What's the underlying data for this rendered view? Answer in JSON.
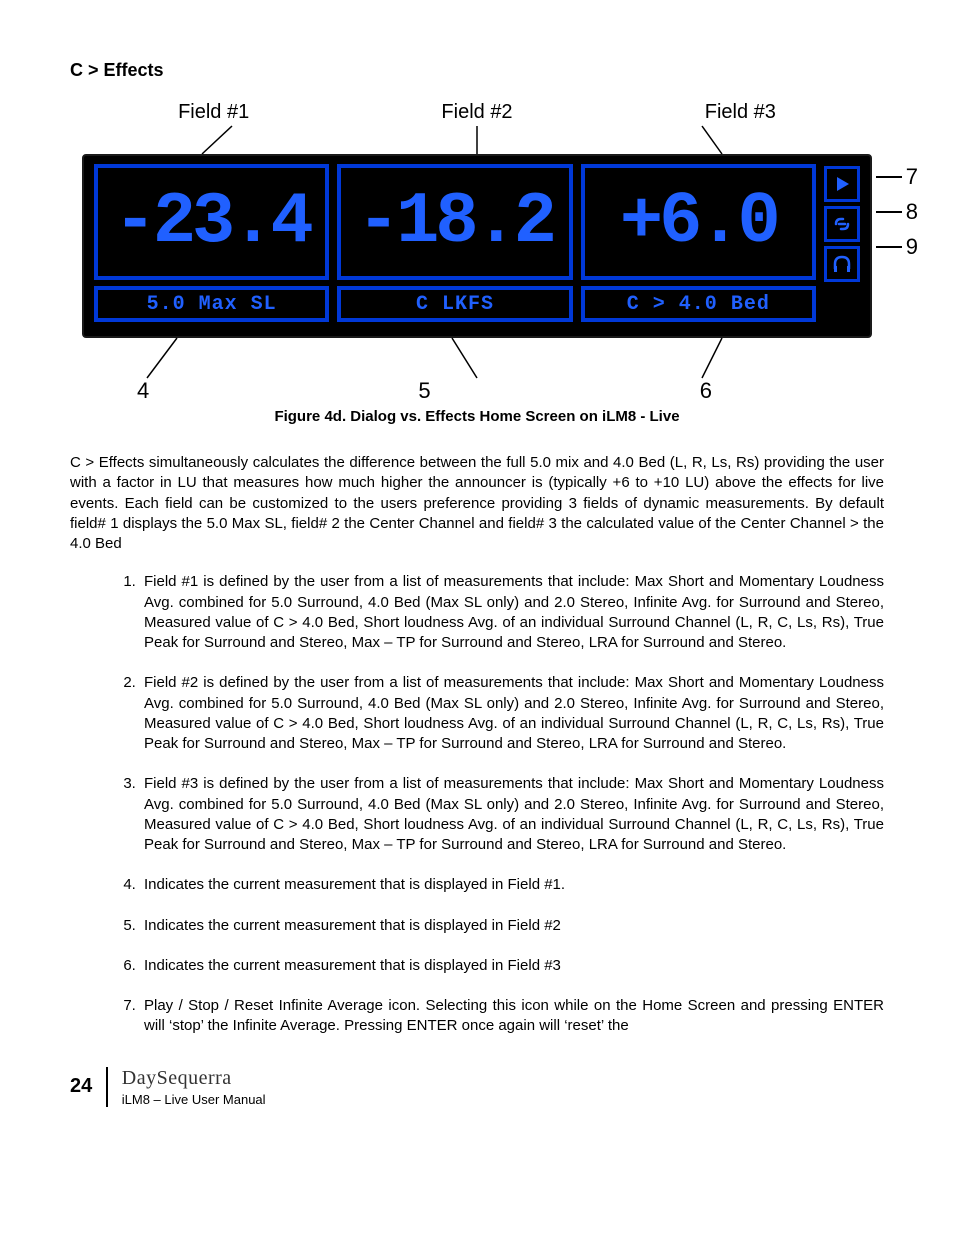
{
  "heading": "C >  Effects",
  "figure": {
    "top_labels": [
      "Field #1",
      "Field #2",
      "Field #3"
    ],
    "fields": [
      {
        "big": "-23.4",
        "small": "5.0 Max SL"
      },
      {
        "big": "-18.2",
        "small": "C LKFS"
      },
      {
        "big": "+6.0",
        "small": "C > 4.0 Bed"
      }
    ],
    "side_nums": [
      "7",
      "8",
      "9"
    ],
    "bottom_nums": [
      "4",
      "5",
      "6"
    ],
    "caption": "Figure 4d.  Dialog vs. Effects Home Screen on iLM8 - Live"
  },
  "paragraph": "C > Effects simultaneously calculates the difference between the full 5.0 mix and 4.0 Bed (L, R, Ls, Rs) providing the user with a factor in LU that measures how much higher the announcer is (typically +6 to +10 LU) above the effects for live events.  Each field can be customized to the users preference providing 3 fields of dynamic measurements.  By default field# 1 displays the 5.0 Max SL, field# 2 the Center Channel and field# 3 the calculated value of the Center Channel > the 4.0 Bed",
  "list": [
    "Field #1 is defined by the user from a list of measurements that include: Max Short and Momentary Loudness Avg. combined for 5.0 Surround, 4.0 Bed (Max SL only) and 2.0 Stereo, Infinite Avg. for Surround and Stereo, Measured value of C > 4.0 Bed, Short loudness Avg. of an individual Surround Channel (L, R, C, Ls, Rs), True Peak for Surround and Stereo, Max – TP for Surround and Stereo, LRA for Surround and Stereo.",
    "Field #2 is defined by the user from a list of measurements that include: Max Short and Momentary Loudness Avg. combined for 5.0 Surround, 4.0 Bed (Max SL only) and 2.0 Stereo, Infinite Avg. for Surround and Stereo, Measured value of C > 4.0 Bed, Short loudness Avg. of an individual Surround Channel (L, R, C, Ls, Rs), True Peak for Surround and Stereo, Max – TP for Surround and Stereo, LRA for Surround and Stereo.",
    "Field #3 is defined by the user from a list of measurements that include: Max Short and Momentary Loudness Avg. combined for 5.0 Surround, 4.0 Bed (Max SL only) and 2.0 Stereo, Infinite Avg. for Surround and Stereo, Measured value of C > 4.0 Bed, Short loudness Avg. of an individual Surround Channel (L, R, C, Ls, Rs), True Peak for Surround and Stereo, Max – TP for Surround and Stereo, LRA for Surround and Stereo.",
    "Indicates the current measurement that is displayed in Field #1.",
    "Indicates the current measurement that is displayed in Field #2",
    "Indicates the current measurement that is displayed in Field #3",
    "Play / Stop / Reset Infinite Average icon. Selecting this icon while on the Home Screen and pressing ENTER will ‘stop’ the Infinite Average.  Pressing ENTER once again will ‘reset’ the"
  ],
  "footer": {
    "page": "24",
    "brand": "DaySequerra",
    "manual": "iLM8 – Live User Manual"
  }
}
